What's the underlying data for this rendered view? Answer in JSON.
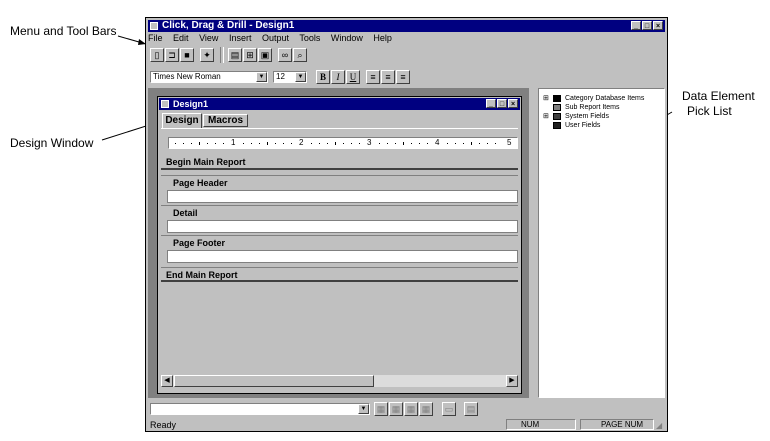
{
  "callouts": {
    "menu_tool_bars": "Menu and Tool Bars",
    "design_window": "Design Window",
    "data_element_1": "Data Element",
    "data_element_2": "Pick List"
  },
  "app": {
    "title": "Click, Drag & Drill - Design1",
    "menu": [
      "File",
      "Edit",
      "View",
      "Insert",
      "Output",
      "Tools",
      "Window",
      "Help"
    ],
    "font_name": "Times New Roman",
    "font_size": "12",
    "format_buttons": [
      "B",
      "I",
      "U"
    ],
    "status": "Ready",
    "status_num": "NUM",
    "status_page_num": "PAGE NUM"
  },
  "design_window": {
    "title": "Design1",
    "tabs": [
      "Design",
      "Macros"
    ],
    "ruler_numbers": [
      "1",
      "2",
      "3",
      "4",
      "5"
    ],
    "sections": {
      "begin": "Begin Main Report",
      "page_header": "Page Header",
      "detail": "Detail",
      "page_footer": "Page Footer",
      "end": "End Main Report"
    }
  },
  "pick_list": {
    "items": [
      "Category Database Items",
      "Sub Report Items",
      "System Fields",
      "User Fields"
    ]
  }
}
